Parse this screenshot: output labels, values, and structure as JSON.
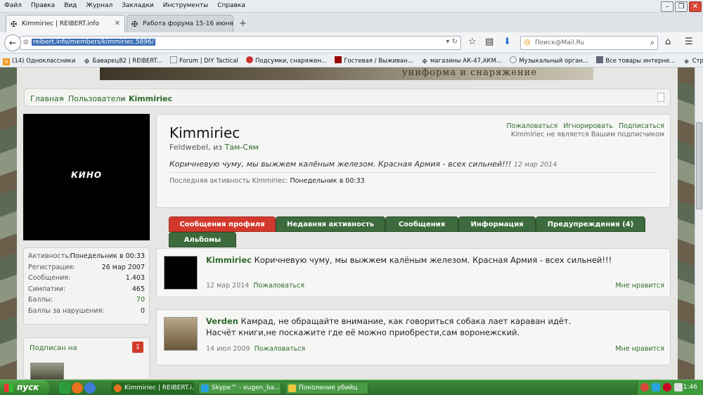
{
  "menu": [
    "Файл",
    "Правка",
    "Вид",
    "Журнал",
    "Закладки",
    "Инструменты",
    "Справка"
  ],
  "tabs": [
    {
      "title": "Kimmiriec | REIBERT.info"
    },
    {
      "title": "Работа форума 15-16 июня ..."
    }
  ],
  "url": "reibert.info/members/kimmiriec.5896/",
  "search_placeholder": "Поиск@Mail.Ru",
  "bookmarks": [
    "(14) Одноклассники",
    "Баварец82 | REIBERT...",
    "Forum | DIY Tactical",
    "Подсумки, снаряжен...",
    "Гостевая / Выживан...",
    "магазины АК-47,АКМ...",
    "Музыкальный орган...",
    "Все товары интерне...",
    "Страйкбольное ору..."
  ],
  "banner_text": "униформа и снаряжение",
  "breadcrumb": {
    "home": "Главная",
    "users": "Пользователи",
    "current": "Kimmiriec"
  },
  "avatar_text": "КИНО",
  "profile": {
    "username": "Kimmiriec",
    "title": "Feldwebel",
    "from_label": ", из ",
    "location": "Там-Сям",
    "status": "Коричневую чуму, мы выжжем калёным железом. Красная Армия - всех сильней!!!",
    "status_date": "12 мар 2014",
    "last_activity_label": "Последняя активность Kimmiriec:",
    "last_activity": "Понедельник в 00:33",
    "actions": [
      "Пожаловаться",
      "Игнорировать",
      "Подписаться"
    ],
    "subscription_note": "Kimmiriec не является Вашим подписчиком"
  },
  "stats": [
    {
      "k": "Активность:",
      "v": "Понедельник в 00:33"
    },
    {
      "k": "Регистрация:",
      "v": "26 мар 2007"
    },
    {
      "k": "Сообщения:",
      "v": "1.403"
    },
    {
      "k": "Симпатии:",
      "v": "465"
    },
    {
      "k": "Баллы:",
      "v": "70"
    },
    {
      "k": "Баллы за нарушения:",
      "v": "0"
    }
  ],
  "subscribed": {
    "label": "Подписан на",
    "count": "1"
  },
  "profile_tabs": [
    "Сообщения профиля",
    "Недавняя активность",
    "Сообщения",
    "Информация",
    "Предупреждения (4)",
    "Альбомы"
  ],
  "posts": [
    {
      "author": "Kimmiriec",
      "text": "Коричневую чуму, мы выжжем калёным железом. Красная Армия - всех сильней!!!",
      "text2": "",
      "date": "12 мар 2014",
      "report": "Пожаловаться",
      "like": "Мне нравится"
    },
    {
      "author": "Verden",
      "text": "Камрад, не обращайте внимание, как говориться собака лает караван идёт.",
      "text2": "Насчёт книги,не поскажите где её можно приобрести,сам воронежский.",
      "date": "14 июл 2009",
      "report": "Пожаловаться",
      "like": "Мне нравится"
    }
  ],
  "taskbar": {
    "start": "пуск",
    "items": [
      "Kimmiriec | REIBERT.i...",
      "Skype™ - eugen_ba...",
      "Поколение убийц"
    ],
    "clock": "1:46"
  },
  "colors": {
    "accent_green": "#2e6b2e",
    "tab_green": "#3d6b3d",
    "tab_active_red": "#d2392c"
  }
}
